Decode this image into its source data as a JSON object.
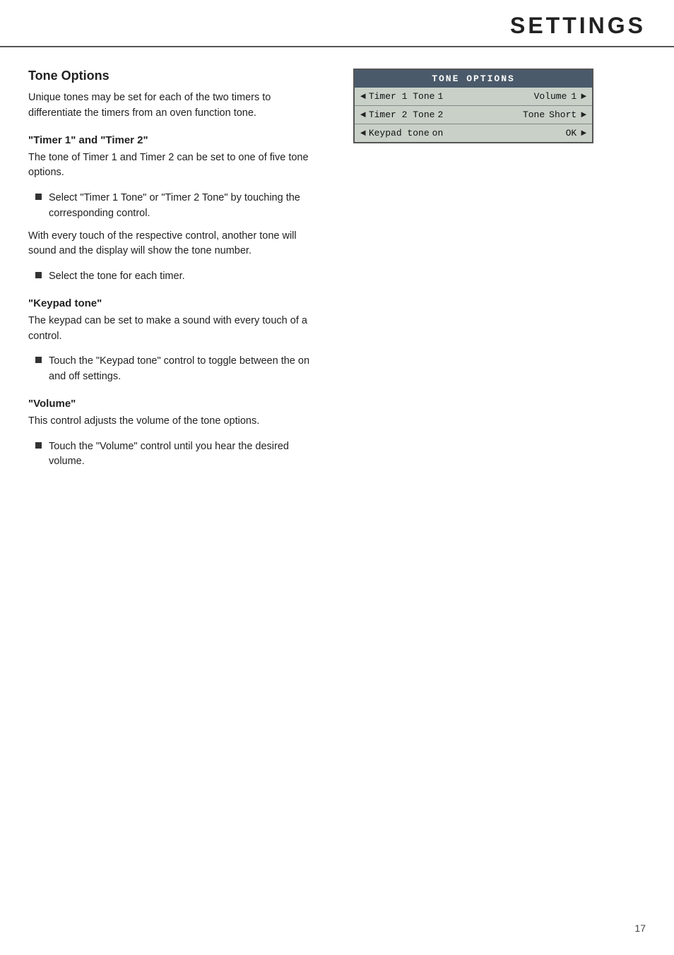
{
  "header": {
    "title": "SETTINGS"
  },
  "main": {
    "section_title": "Tone Options",
    "intro_text": "Unique tones may be set for each of the two timers to differentiate the timers from an oven function tone.",
    "subsections": [
      {
        "id": "timer1-timer2",
        "title": "\"Timer 1\" and \"Timer 2\"",
        "paragraph": "The tone of Timer 1 and Timer 2 can be set to one of five tone options.",
        "bullets": [
          "Select \"Timer 1 Tone\" or \"Timer 2 Tone\" by touching the corresponding control."
        ]
      },
      {
        "id": "between-touch",
        "paragraph": "With every touch of the respective control, another tone will sound and the display will show the tone number.",
        "bullets": [
          "Select the tone for each timer."
        ]
      },
      {
        "id": "keypad-tone",
        "title": "\"Keypad tone\"",
        "paragraph": "The keypad can be set to make a sound with every touch of a control.",
        "bullets": [
          "Touch the \"Keypad tone\" control to toggle between the on and off settings."
        ]
      },
      {
        "id": "volume",
        "title": "\"Volume\"",
        "paragraph": "This control adjusts the volume of the tone options.",
        "bullets": [
          "Touch the \"Volume\" control until you hear the desired volume."
        ]
      }
    ]
  },
  "display": {
    "header": "TONE OPTIONS",
    "rows": [
      {
        "label_arrow": "◄",
        "label_name": "Timer 1 Tone",
        "label_value": "1",
        "right_label": "Volume",
        "right_value": "1",
        "right_arrow": "►"
      },
      {
        "label_arrow": "◄",
        "label_name": "Timer 2 Tone",
        "label_value": "2",
        "right_label": "Tone",
        "right_value": "Short",
        "right_arrow": "►"
      },
      {
        "label_arrow": "◄",
        "label_name": "Keypad tone",
        "label_value": "on",
        "right_label": "",
        "right_value": "OK",
        "right_arrow": "►"
      }
    ]
  },
  "page_number": "17"
}
